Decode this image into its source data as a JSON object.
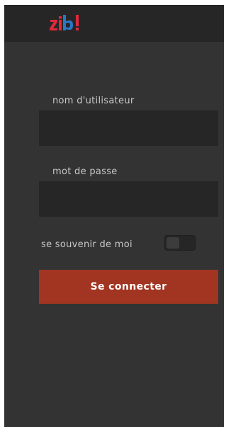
{
  "app": {
    "logo_text": "zib!",
    "brand_colors": {
      "logo_red": "#e0283c",
      "logo_blue": "#2a78c5",
      "accent": "#a13522"
    }
  },
  "login": {
    "username_label": "nom d'utilisateur",
    "username_value": "",
    "password_label": "mot de passe",
    "password_value": "",
    "remember_label": "se souvenir de moi",
    "remember_checked": false,
    "submit_label": "Se connecter"
  }
}
